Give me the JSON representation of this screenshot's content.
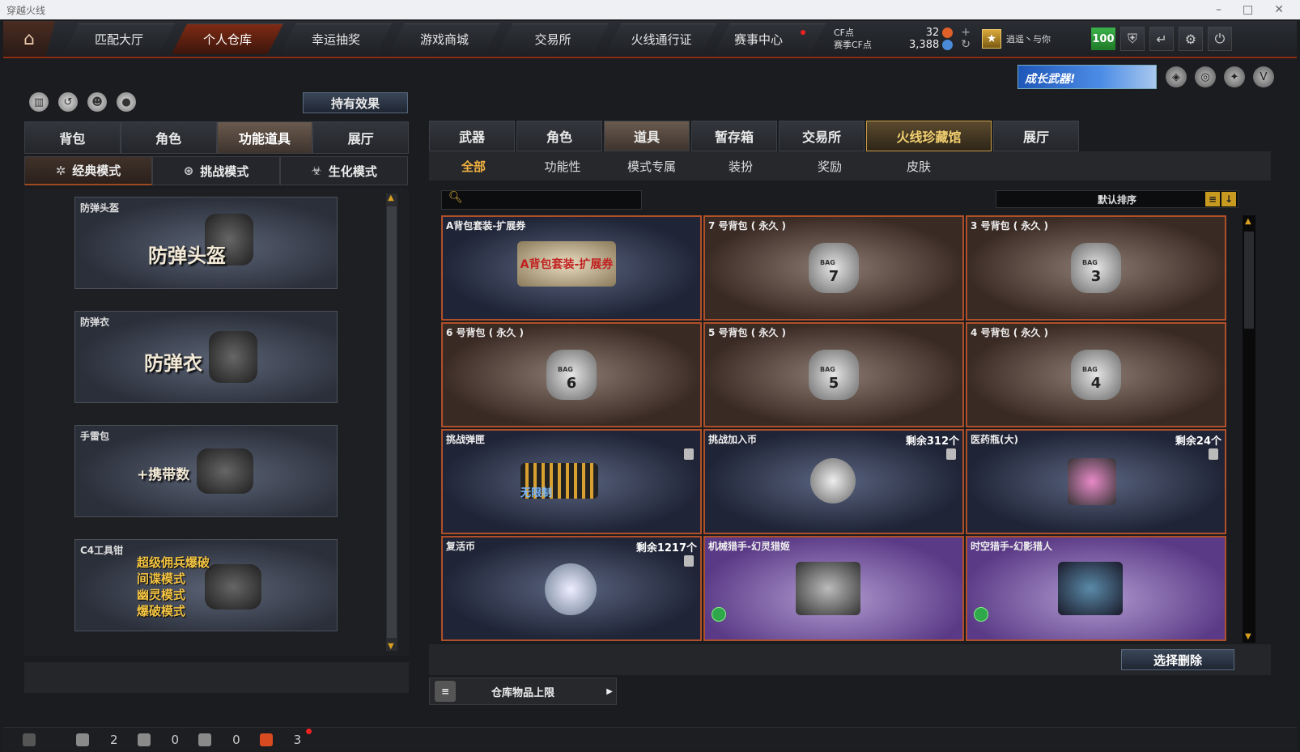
{
  "window": {
    "title": "穿越火线"
  },
  "nav": {
    "tabs": [
      {
        "label": "匹配大厅"
      },
      {
        "label": "个人仓库"
      },
      {
        "label": "幸运抽奖"
      },
      {
        "label": "游戏商城"
      },
      {
        "label": "交易所"
      },
      {
        "label": "火线通行证"
      },
      {
        "label": "赛事中心"
      }
    ]
  },
  "currency": {
    "cf_label": "CF点",
    "season_label": "赛季CF点",
    "cf_value": "32",
    "season_value": "3,388"
  },
  "user": {
    "name": "逍遥丶与你",
    "level": "100"
  },
  "promo": {
    "text": "成长武器!"
  },
  "left": {
    "effect_button": "持有效果",
    "tabs": [
      "背包",
      "角色",
      "功能道具",
      "展厅"
    ],
    "modes": [
      "经典模式",
      "挑战模式",
      "生化模式"
    ],
    "items": [
      {
        "name": "防弹头盔",
        "big": "防弹头盔"
      },
      {
        "name": "防弹衣",
        "big": "防弹衣"
      },
      {
        "name": "手雷包",
        "big": "+携带数"
      },
      {
        "name": "C4工具钳",
        "lines": [
          "超级佣兵爆破",
          "间谍模式",
          "幽灵模式",
          "爆破模式"
        ]
      }
    ]
  },
  "right": {
    "tabs": [
      "武器",
      "角色",
      "道具",
      "暂存箱",
      "交易所",
      "火线珍藏馆",
      "展厅"
    ],
    "subtabs": [
      "全部",
      "功能性",
      "模式专属",
      "装扮",
      "奖励",
      "皮肤"
    ],
    "sort_label": "默认排序",
    "cards": [
      {
        "name": "A背包套装-扩展券",
        "style": "blue",
        "art": "A背包套装-扩展券"
      },
      {
        "name": "7 号背包 ( 永久 )",
        "style": "brown",
        "bag": "7"
      },
      {
        "name": "3 号背包 ( 永久 )",
        "style": "brown",
        "bag": "3"
      },
      {
        "name": "6 号背包 ( 永久 )",
        "style": "brown",
        "bag": "6"
      },
      {
        "name": "5 号背包 ( 永久 )",
        "style": "brown",
        "bag": "5"
      },
      {
        "name": "4 号背包 ( 永久 )",
        "style": "brown",
        "bag": "4"
      },
      {
        "name": "挑战弹匣",
        "style": "blue",
        "art": "无限制"
      },
      {
        "name": "挑战加入币",
        "style": "blue",
        "remain": "剩余312个"
      },
      {
        "name": "医药瓶(大)",
        "style": "blue",
        "remain": "剩余24个"
      },
      {
        "name": "复活币",
        "style": "blue",
        "remain": "剩余1217个"
      },
      {
        "name": "机械猎手-幻灵猎姬",
        "style": "purple"
      },
      {
        "name": "时空猎手-幻影猎人",
        "style": "purple"
      }
    ],
    "delete_button": "选择删除",
    "storage_limit": "仓库物品上限"
  },
  "statusbar": {
    "items": [
      "2",
      "0",
      "0",
      "3"
    ]
  },
  "colors": {
    "accent": "#b0502a",
    "gold": "#f0b040",
    "active_nav": "#7e2a14"
  }
}
